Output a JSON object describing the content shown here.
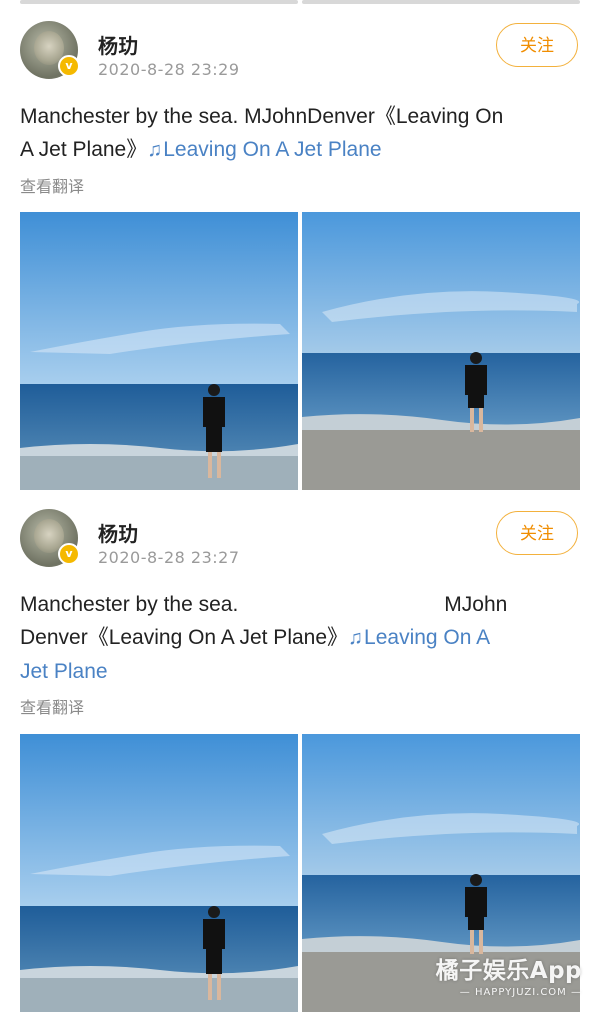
{
  "posts": [
    {
      "username": "杨玏",
      "timestamp": "2020-8-28 23:29",
      "follow_label": "关注",
      "text_lines": [
        "Manchester by the sea. MJohnDenver《Leaving On",
        "A Jet Plane》"
      ],
      "music_line2": "Leaving On A Jet Plane",
      "translate_label": "查看翻译"
    },
    {
      "username": "杨玏",
      "timestamp": "2020-8-28 23:27",
      "follow_label": "关注",
      "line1_a": "Manchester by the sea.",
      "line1_b": "MJohn",
      "line2": "Denver《Leaving On A Jet Plane》",
      "music_part": "Leaving On A",
      "line3": "Jet Plane",
      "translate_label": "查看翻译"
    }
  ],
  "watermark": {
    "main": "橘子娱乐App",
    "sub": "— HAPPYJUZI.COM —"
  },
  "colors": {
    "accent": "#f08d00",
    "link": "#4a82c4",
    "muted": "#9a9a9a"
  },
  "icons": {
    "music": "music-note-icon",
    "verified": "verified-badge-icon"
  }
}
